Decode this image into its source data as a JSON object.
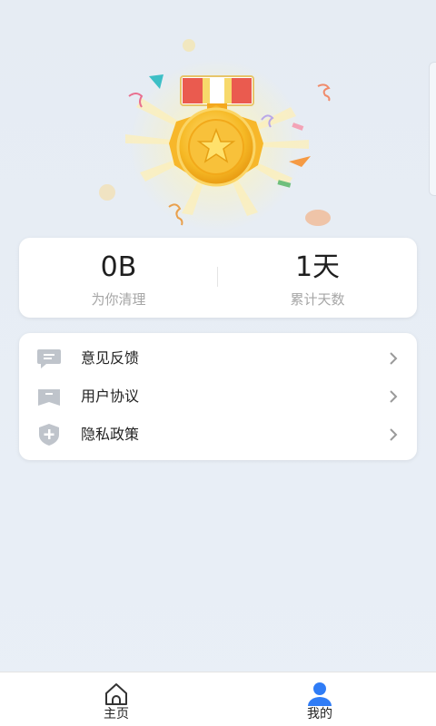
{
  "stats": {
    "cleaned_value": "0B",
    "cleaned_label": "为你清理",
    "days_value": "1天",
    "days_label": "累计天数"
  },
  "menu": {
    "items": [
      {
        "label": "意见反馈",
        "icon": "chat-bubble-icon"
      },
      {
        "label": "用户协议",
        "icon": "bookmark-icon"
      },
      {
        "label": "隐私政策",
        "icon": "shield-plus-icon"
      }
    ]
  },
  "nav": {
    "home_label": "主页",
    "mine_label": "我的"
  },
  "colors": {
    "accent": "#2f7cf6",
    "medal_gold": "#f5b820",
    "ribbon_red": "#ea5b4f",
    "icon_grey": "#bfc4cb"
  }
}
